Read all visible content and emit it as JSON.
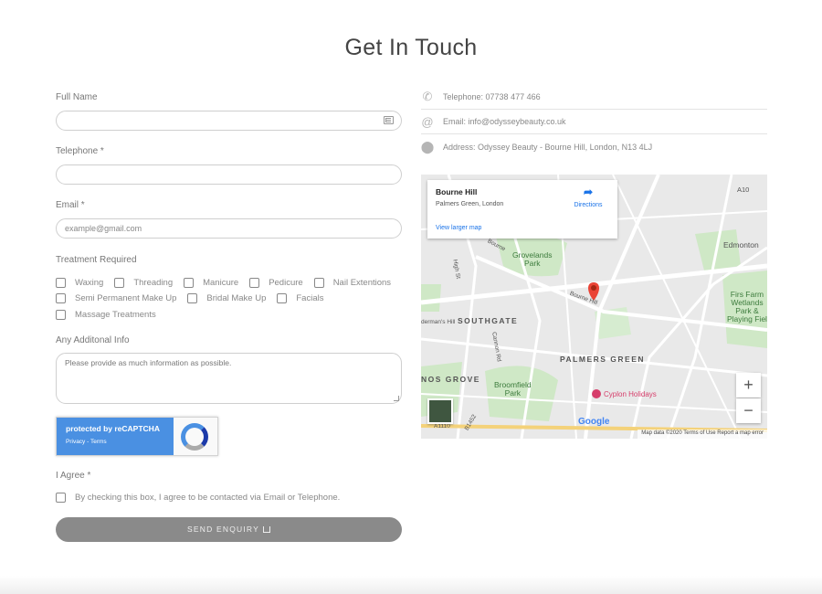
{
  "page": {
    "title": "Get In Touch"
  },
  "form": {
    "full_name_label": "Full Name",
    "full_name_value": "",
    "telephone_label": "Telephone *",
    "telephone_value": "",
    "email_label": "Email *",
    "email_placeholder": "example@gmail.com",
    "treatment_label": "Treatment Required",
    "treatments": [
      "Waxing",
      "Threading",
      "Manicure",
      "Pedicure",
      "Nail Extentions",
      "Semi Permanent Make Up",
      "Bridal Make Up",
      "Facials",
      "Massage Treatments"
    ],
    "info_label": "Any Additonal Info",
    "info_placeholder": "Please provide as much information as possible.",
    "agree_label": "I Agree *",
    "agree_text": "By checking this box, I agree to be contacted via Email or Telephone.",
    "send_label": "SEND ENQUIRY"
  },
  "recaptcha": {
    "title": "protected by reCAPTCHA",
    "links": "Privacy - Terms"
  },
  "contact": {
    "telephone": "Telephone: 07738 477 466",
    "email": "Email: info@odysseybeauty.co.uk",
    "address": "Address: Odyssey Beauty - Bourne Hill, London, N13 4LJ"
  },
  "map": {
    "card_title": "Bourne Hill",
    "card_sub": "Palmers Green, London",
    "card_link": "View larger map",
    "directions": "Directions",
    "labels": {
      "a10": "A10",
      "edmonton": "Edmonton",
      "grovelands": "Grovelands\nPark",
      "firs": "Firs Farm\nWetlands\nPark &\nPlaying Fiel",
      "southgate": "SOUTHGATE",
      "palmers": "PALMERS GREEN",
      "nos_grove": "NOS GROVE",
      "broomfield": "Broomfield\nPark",
      "cyplon": "Cyplon Holidays",
      "bourne_road": "Bourne Hill",
      "bourne_road2": "Bourne",
      "high_st": "High St",
      "cannon": "Cannon Rd",
      "a1110": "A1110",
      "b1452": "B1452",
      "aldermans": "derman's Hill",
      "rd": "Rd"
    },
    "footer": "Map data ©2020   Terms of Use   Report a map error",
    "google": "Google",
    "zoom_in": "+",
    "zoom_out": "−"
  },
  "colors": {
    "accent": "#8a8a8a",
    "map_bg": "#e8e8e8",
    "park_green": "#c8e6c1",
    "pin": "#ea4335"
  }
}
